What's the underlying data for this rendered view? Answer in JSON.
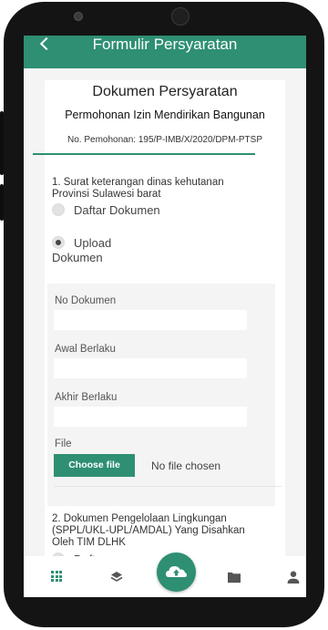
{
  "app_bar": {
    "title": "Formulir Persyaratan"
  },
  "document": {
    "title": "Dokumen Persyaratan",
    "subtitle": "Permohonan Izin Mendirikan Bangunan",
    "application_number": "No. Pemohonan: 195/P-IMB/X/2020/DPM-PTSP"
  },
  "requirements": [
    {
      "label": "1. Surat keterangan dinas kehutanan Provinsi Sulawesi barat",
      "options": [
        {
          "label": "Daftar Dokumen",
          "selected": false
        },
        {
          "label": "Upload Dokumen",
          "selected": true
        }
      ],
      "form": {
        "no_dokumen_label": "No Dokumen",
        "no_dokumen_value": "",
        "awal_berlaku_label": "Awal Berlaku",
        "awal_berlaku_value": "",
        "akhir_berlaku_label": "Akhir Berlaku",
        "akhir_berlaku_value": "",
        "file_label": "File",
        "choose_file_label": "Choose file",
        "file_status": "No file chosen"
      }
    },
    {
      "label": "2. Dokumen Pengelolaan Lingkungan (SPPL/UKL-UPL/AMDAL) Yang Disahkan Oleh TIM DLHK",
      "options": [
        {
          "label": "Daftar",
          "selected": false
        }
      ]
    }
  ],
  "bottom_nav": {
    "items": [
      {
        "icon": "grid-icon",
        "active": true
      },
      {
        "icon": "layers-icon",
        "active": false
      },
      {
        "icon": "cloud-upload-icon",
        "active": false
      },
      {
        "icon": "folder-icon",
        "active": false
      },
      {
        "icon": "user-icon",
        "active": false
      }
    ]
  },
  "colors": {
    "accent": "#2e8f73",
    "panel": "#f4f4f4"
  }
}
